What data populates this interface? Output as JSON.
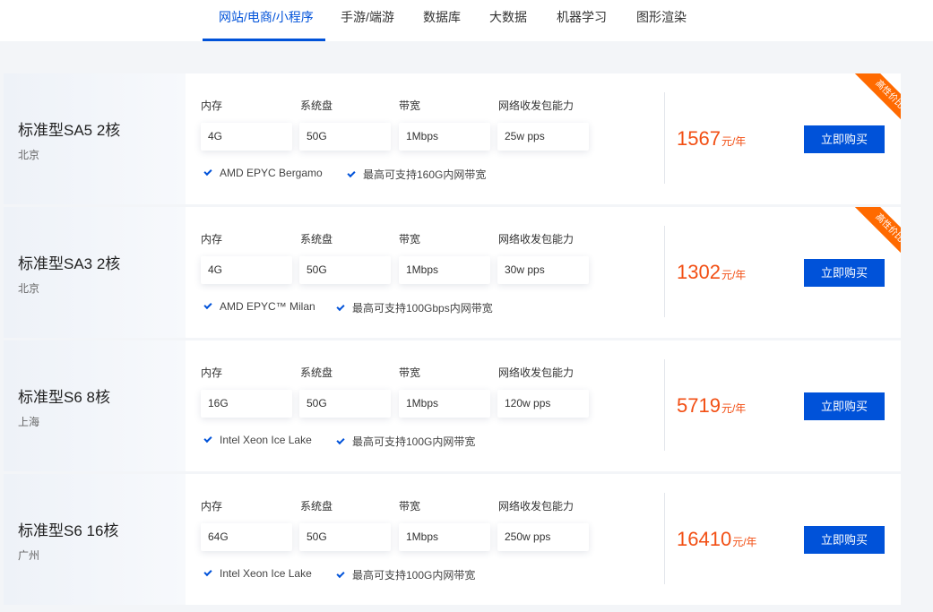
{
  "tabs": [
    {
      "label": "网站/电商/小程序",
      "active": true
    },
    {
      "label": "手游/端游",
      "active": false
    },
    {
      "label": "数据库",
      "active": false
    },
    {
      "label": "大数据",
      "active": false
    },
    {
      "label": "机器学习",
      "active": false
    },
    {
      "label": "图形渲染",
      "active": false
    }
  ],
  "spec_labels": {
    "memory": "内存",
    "disk": "系统盘",
    "bandwidth": "带宽",
    "pps": "网络收发包能力"
  },
  "buy_label": "立即购买",
  "badge_label": "高性价比",
  "colors": {
    "accent": "#0052d9",
    "price": "#f24f14",
    "badge": "#ff6a00"
  },
  "products": [
    {
      "title": "标准型SA5 2核",
      "region": "北京",
      "memory": "4G",
      "disk": "50G",
      "bandwidth": "1Mbps",
      "pps": "25w pps",
      "features": [
        "AMD EPYC Bergamo",
        "最高可支持160G内网带宽"
      ],
      "price": "1567",
      "unit": "元/年",
      "badge": true
    },
    {
      "title": "标准型SA3 2核",
      "region": "北京",
      "memory": "4G",
      "disk": "50G",
      "bandwidth": "1Mbps",
      "pps": "30w pps",
      "features": [
        "AMD EPYC™ Milan",
        "最高可支持100Gbps内网带宽"
      ],
      "price": "1302",
      "unit": "元/年",
      "badge": true
    },
    {
      "title": "标准型S6 8核",
      "region": "上海",
      "memory": "16G",
      "disk": "50G",
      "bandwidth": "1Mbps",
      "pps": "120w pps",
      "features": [
        "Intel Xeon Ice Lake",
        "最高可支持100G内网带宽"
      ],
      "price": "5719",
      "unit": "元/年",
      "badge": false
    },
    {
      "title": "标准型S6 16核",
      "region": "广州",
      "memory": "64G",
      "disk": "50G",
      "bandwidth": "1Mbps",
      "pps": "250w pps",
      "features": [
        "Intel Xeon Ice Lake",
        "最高可支持100G内网带宽"
      ],
      "price": "16410",
      "unit": "元/年",
      "badge": false
    }
  ]
}
